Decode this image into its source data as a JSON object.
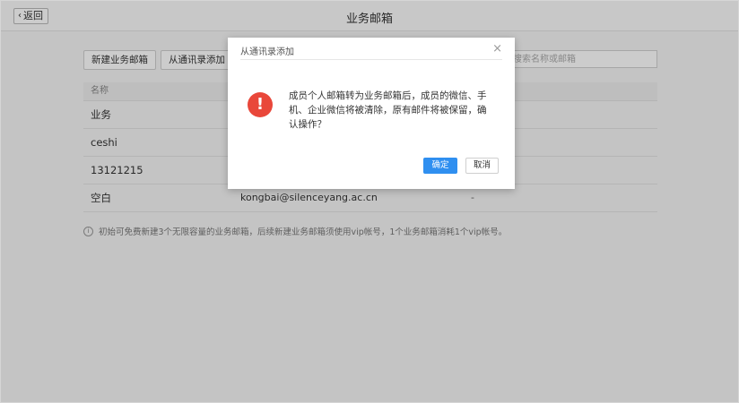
{
  "header": {
    "back_label": "返回",
    "title": "业务邮箱"
  },
  "toolbar": {
    "new_label": "新建业务邮箱",
    "import_label": "从通讯录添加",
    "search_placeholder": "搜索名称或邮箱"
  },
  "table": {
    "header_name": "名称",
    "rows": [
      {
        "name": "业务",
        "email": "",
        "extra": ""
      },
      {
        "name": "ceshi",
        "email": "",
        "extra": ""
      },
      {
        "name": "13121215",
        "email": "",
        "extra": ""
      },
      {
        "name": "空白",
        "email": "kongbai@silenceyang.ac.cn",
        "extra": "-"
      }
    ]
  },
  "note": "初始可免费新建3个无限容量的业务邮箱，后续新建业务邮箱须使用vip帐号，1个业务邮箱消耗1个vip帐号。",
  "dialog": {
    "title": "从通讯录添加",
    "close_icon": "close-icon",
    "message": "成员个人邮箱转为业务邮箱后，成员的微信、手机、企业微信将被清除，原有邮件将被保留，确认操作？",
    "ok_label": "确定",
    "cancel_label": "取消"
  },
  "colors": {
    "primary": "#2f8ff0",
    "danger": "#e9473a"
  }
}
